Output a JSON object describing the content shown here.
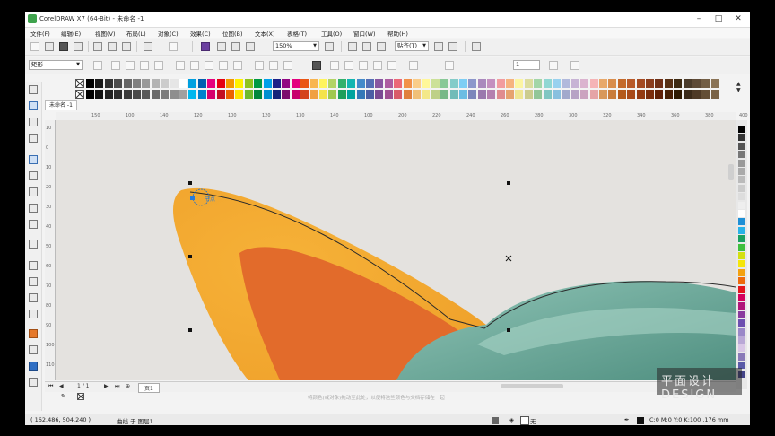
{
  "window": {
    "title": "CorelDRAW X7 (64-Bit) - 未命名 -1",
    "controls": [
      "–",
      "□",
      "✕"
    ]
  },
  "menu": [
    "文件(F)",
    "编辑(E)",
    "视图(V)",
    "布局(L)",
    "对象(C)",
    "效果(C)",
    "位图(B)",
    "文本(X)",
    "表格(T)",
    "工具(O)",
    "窗口(W)",
    "帮助(H)"
  ],
  "toolbar": {
    "zoom_value": "150%",
    "snap_label": "贴齐(T)"
  },
  "propertybar": {
    "object_type": "矩形",
    "snap_combo": "1"
  },
  "doc_tab": "未命名 -1",
  "rulers": {
    "h_labels": [
      "150",
      "100",
      "140",
      "120",
      "100",
      "120",
      "130",
      "140",
      "100",
      "200",
      "220",
      "240",
      "260",
      "280",
      "300",
      "320",
      "340",
      "360",
      "380",
      "400"
    ],
    "v_labels": [
      "10",
      "0",
      "10",
      "20",
      "30",
      "40",
      "50",
      "60",
      "70",
      "80",
      "90",
      "100",
      "110"
    ]
  },
  "canvas": {
    "node_label": "节点",
    "colors": {
      "background": "#e4e2df",
      "petal_outer": "#f0a830",
      "petal_inner": "#e06a2a",
      "teal": "#6aa89a"
    }
  },
  "page_nav": {
    "page_count": "1 / 1",
    "page_label": "页1"
  },
  "hint_text": "将颜色(或对象)拖动至此处，以便将这些颜色与文档存储在一起",
  "status": {
    "coords": "( 162.486, 504.240 )",
    "object_info": "曲线 于 图层1",
    "fill": "无",
    "outline": "C:0 M:0 Y:0 K:100  .176 mm"
  },
  "watermark": "平面设计 DESIGN"
}
